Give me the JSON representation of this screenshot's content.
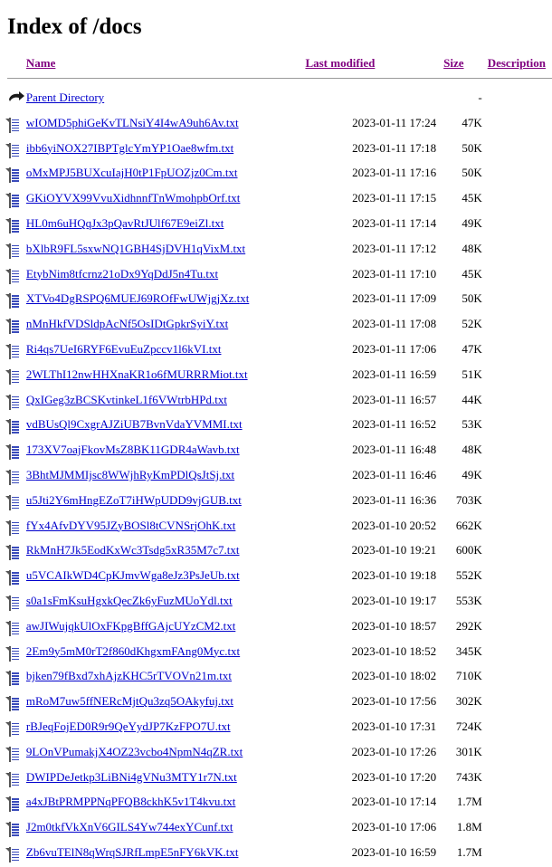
{
  "page": {
    "title": "Index of /docs"
  },
  "colors": {
    "link": "#0000cc",
    "header_link": "#800080",
    "rule": "#999999",
    "background": "#ffffff"
  },
  "table": {
    "columns": [
      {
        "key": "name",
        "label": "Name",
        "icon": ""
      },
      {
        "key": "last_modified",
        "label": "Last modified"
      },
      {
        "key": "size",
        "label": "Size"
      },
      {
        "key": "description",
        "label": "Description"
      }
    ],
    "parent": {
      "icon": "parent-directory-icon",
      "label": "Parent Directory",
      "last_modified": "",
      "size": "-",
      "description": ""
    },
    "rows": [
      {
        "icon": "text-file-icon",
        "name": "wIOMD5phiGeKvTLNsiY4I4wA9uh6Av.txt",
        "last_modified": "2023-01-11 17:24",
        "size": "47K",
        "description": ""
      },
      {
        "icon": "text-file-icon",
        "name": "ibb6yiNOX27IBPTglcYmYP1Oae8wfm.txt",
        "last_modified": "2023-01-11 17:18",
        "size": "50K",
        "description": ""
      },
      {
        "icon": "text-file-icon",
        "name": "oMxMPJ5BUXcuIajH0tP1FpUOZjz0Cm.txt",
        "last_modified": "2023-01-11 17:16",
        "size": "50K",
        "description": ""
      },
      {
        "icon": "text-file-icon",
        "name": "GKiOYVX99VvuXidhnnfTnWmohpbOrf.txt",
        "last_modified": "2023-01-11 17:15",
        "size": "45K",
        "description": ""
      },
      {
        "icon": "text-file-icon",
        "name": "HL0m6uHQqJx3pQavRtJUlf67E9eiZl.txt",
        "last_modified": "2023-01-11 17:14",
        "size": "49K",
        "description": ""
      },
      {
        "icon": "text-file-icon",
        "name": "bXlbR9FL5sxwNQ1GBH4SjDVH1qVixM.txt",
        "last_modified": "2023-01-11 17:12",
        "size": "48K",
        "description": ""
      },
      {
        "icon": "text-file-icon",
        "name": "EtybNim8tfcrnz21oDx9YqDdJ5n4Tu.txt",
        "last_modified": "2023-01-11 17:10",
        "size": "45K",
        "description": ""
      },
      {
        "icon": "text-file-icon",
        "name": "XTVo4DgRSPQ6MUEJ69ROfFwUWjgjXz.txt",
        "last_modified": "2023-01-11 17:09",
        "size": "50K",
        "description": ""
      },
      {
        "icon": "text-file-icon",
        "name": "nMnHkfVDSldpAcNf5OsIDtGpkrSyiY.txt",
        "last_modified": "2023-01-11 17:08",
        "size": "52K",
        "description": ""
      },
      {
        "icon": "text-file-icon",
        "name": "Ri4qs7UeI6RYF6EvuEuZpccv1l6kVI.txt",
        "last_modified": "2023-01-11 17:06",
        "size": "47K",
        "description": ""
      },
      {
        "icon": "text-file-icon",
        "name": "2WLThI12nwHHXnaKR1o6fMURRRMiot.txt",
        "last_modified": "2023-01-11 16:59",
        "size": "51K",
        "description": ""
      },
      {
        "icon": "text-file-icon",
        "name": "QxIGeg3zBCSKvtinkeL1f6VWtrbHPd.txt",
        "last_modified": "2023-01-11 16:57",
        "size": "44K",
        "description": ""
      },
      {
        "icon": "text-file-icon",
        "name": "vdBUsQl9CxgrAJZiUB7BvnVdaYVMMI.txt",
        "last_modified": "2023-01-11 16:52",
        "size": "53K",
        "description": ""
      },
      {
        "icon": "text-file-icon",
        "name": "173XV7oajFkovMsZ8BK11GDR4aWavb.txt",
        "last_modified": "2023-01-11 16:48",
        "size": "48K",
        "description": ""
      },
      {
        "icon": "text-file-icon",
        "name": "3BhtMJMMIjsc8WWjhRyKmPDlQsJtSj.txt",
        "last_modified": "2023-01-11 16:46",
        "size": "49K",
        "description": ""
      },
      {
        "icon": "text-file-icon",
        "name": "u5Jti2Y6mHngEZoT7iHWpUDD9vjGUB.txt",
        "last_modified": "2023-01-11 16:36",
        "size": "703K",
        "description": ""
      },
      {
        "icon": "text-file-icon",
        "name": "fYx4AfvDYV95JZyBOSl8tCVNSrjOhK.txt",
        "last_modified": "2023-01-10 20:52",
        "size": "662K",
        "description": ""
      },
      {
        "icon": "text-file-icon",
        "name": "RkMnH7Jk5EodKxWc3Tsdg5xR35M7c7.txt",
        "last_modified": "2023-01-10 19:21",
        "size": "600K",
        "description": ""
      },
      {
        "icon": "text-file-icon",
        "name": "u5VCAIkWD4CpKJmvWga8eJz3PsJeUb.txt",
        "last_modified": "2023-01-10 19:18",
        "size": "552K",
        "description": ""
      },
      {
        "icon": "text-file-icon",
        "name": "s0a1sFmKsuHgxkQecZk6yFuzMUoYdl.txt",
        "last_modified": "2023-01-10 19:17",
        "size": "553K",
        "description": ""
      },
      {
        "icon": "text-file-icon",
        "name": "awJIWujqkUlOxFKpgBffGAjcUYzCM2.txt",
        "last_modified": "2023-01-10 18:57",
        "size": "292K",
        "description": ""
      },
      {
        "icon": "text-file-icon",
        "name": "2Em9y5mM0rT2f860dKhgxmFAng0Myc.txt",
        "last_modified": "2023-01-10 18:52",
        "size": "345K",
        "description": ""
      },
      {
        "icon": "text-file-icon",
        "name": "bjken79fBxd7xhAjzKHC5rTVOVn21m.txt",
        "last_modified": "2023-01-10 18:02",
        "size": "710K",
        "description": ""
      },
      {
        "icon": "text-file-icon",
        "name": "mRoM7uw5ffNERcMjtQu3zq5OAkyfuj.txt",
        "last_modified": "2023-01-10 17:56",
        "size": "302K",
        "description": ""
      },
      {
        "icon": "text-file-icon",
        "name": "rBJeqFojED0R9r9QeYydJP7KzFPO7U.txt",
        "last_modified": "2023-01-10 17:31",
        "size": "724K",
        "description": ""
      },
      {
        "icon": "text-file-icon",
        "name": "9LOnVPumakjX4OZ23vcbo4NpmN4qZR.txt",
        "last_modified": "2023-01-10 17:26",
        "size": "301K",
        "description": ""
      },
      {
        "icon": "text-file-icon",
        "name": "DWIPDeJetkp3LiBNi4gVNu3MTY1r7N.txt",
        "last_modified": "2023-01-10 17:20",
        "size": "743K",
        "description": ""
      },
      {
        "icon": "text-file-icon",
        "name": "a4xJBtPRMPPNqPFQB8ckhK5v1T4kvu.txt",
        "last_modified": "2023-01-10 17:14",
        "size": "1.7M",
        "description": ""
      },
      {
        "icon": "text-file-icon",
        "name": "J2m0tkfVkXnV6GILS4Yw744exYCunf.txt",
        "last_modified": "2023-01-10 17:06",
        "size": "1.8M",
        "description": ""
      },
      {
        "icon": "text-file-icon",
        "name": "Zb6vuTElN8qWrqSJRfLmpE5nFY6kVK.txt",
        "last_modified": "2023-01-10 16:59",
        "size": "1.7M",
        "description": ""
      }
    ]
  }
}
